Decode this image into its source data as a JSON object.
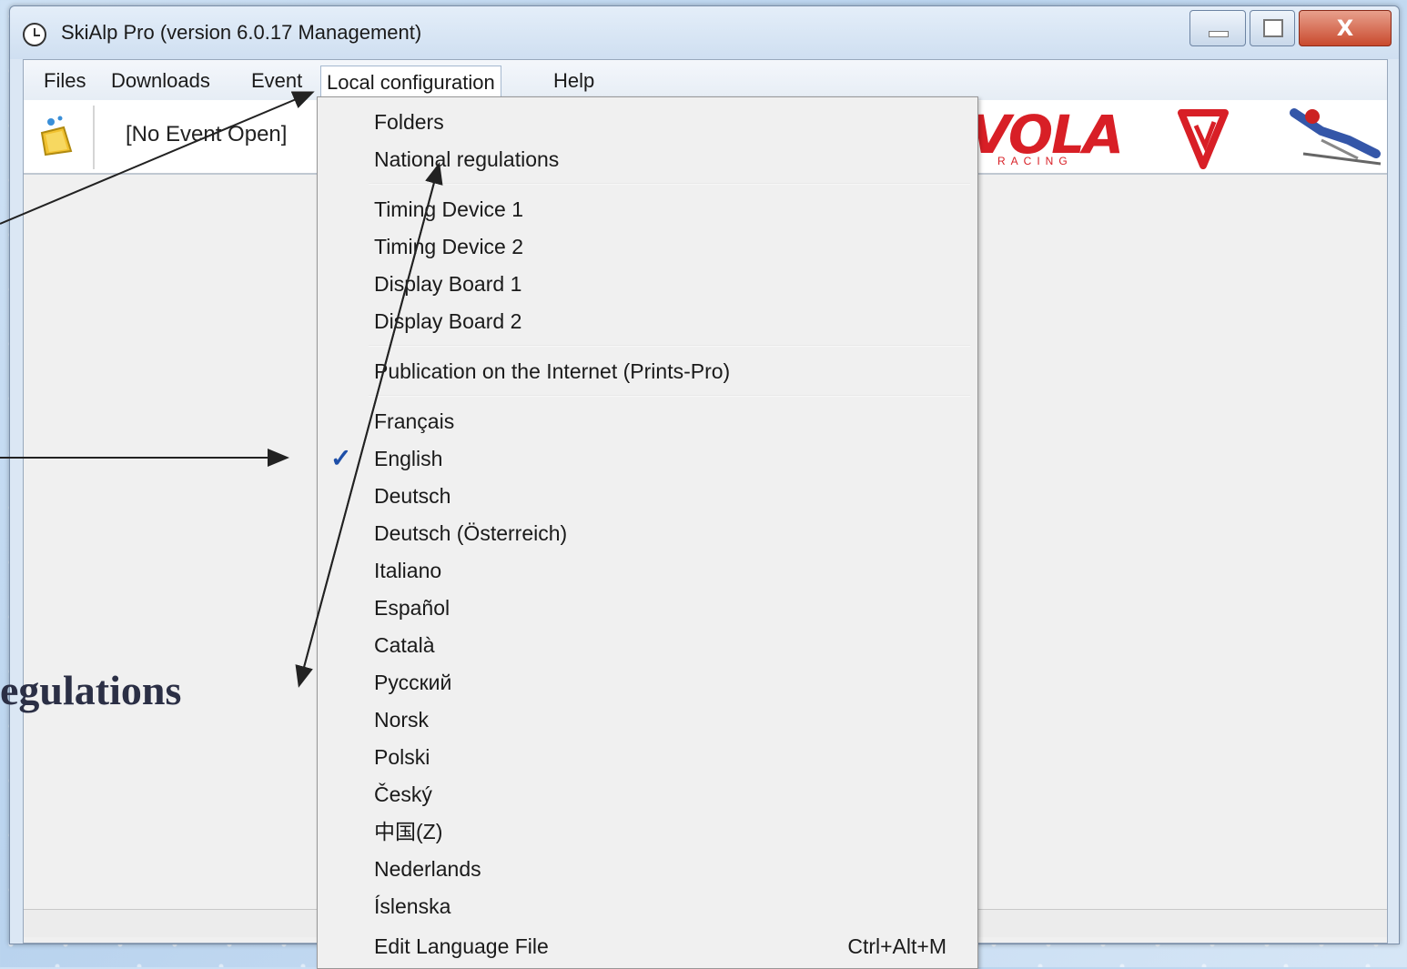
{
  "window": {
    "title": "SkiAlp Pro (version 6.0.17 Management)",
    "close_glyph": "X"
  },
  "menubar": {
    "items": [
      "Files",
      "Downloads",
      "Event",
      "Local configuration",
      "Help"
    ]
  },
  "toolbar": {
    "event_status": "[No Event Open]",
    "logo_text": "VOLA",
    "logo_sub": "RACING"
  },
  "dropdown": {
    "group1": [
      "Folders",
      "National regulations"
    ],
    "group2": [
      "Timing Device 1",
      "Timing Device 2",
      "Display Board 1",
      "Display Board 2"
    ],
    "group3": [
      "Publication on the Internet (Prints-Pro)"
    ],
    "languages": [
      "Français",
      "English",
      "Deutsch",
      "Deutsch (Österreich)",
      "Italiano",
      "Español",
      "Català",
      "Русский",
      "Norsk",
      "Polski",
      "Český",
      "中国(Z)",
      "Nederlands",
      "Íslenska"
    ],
    "checked": "English",
    "edit_language": "Edit Language File",
    "edit_language_shortcut": "Ctrl+Alt+M"
  },
  "slide": {
    "caption_fragment": "egulations"
  },
  "colors": {
    "logo_red": "#d81f26",
    "check_blue": "#1e4fa8"
  }
}
